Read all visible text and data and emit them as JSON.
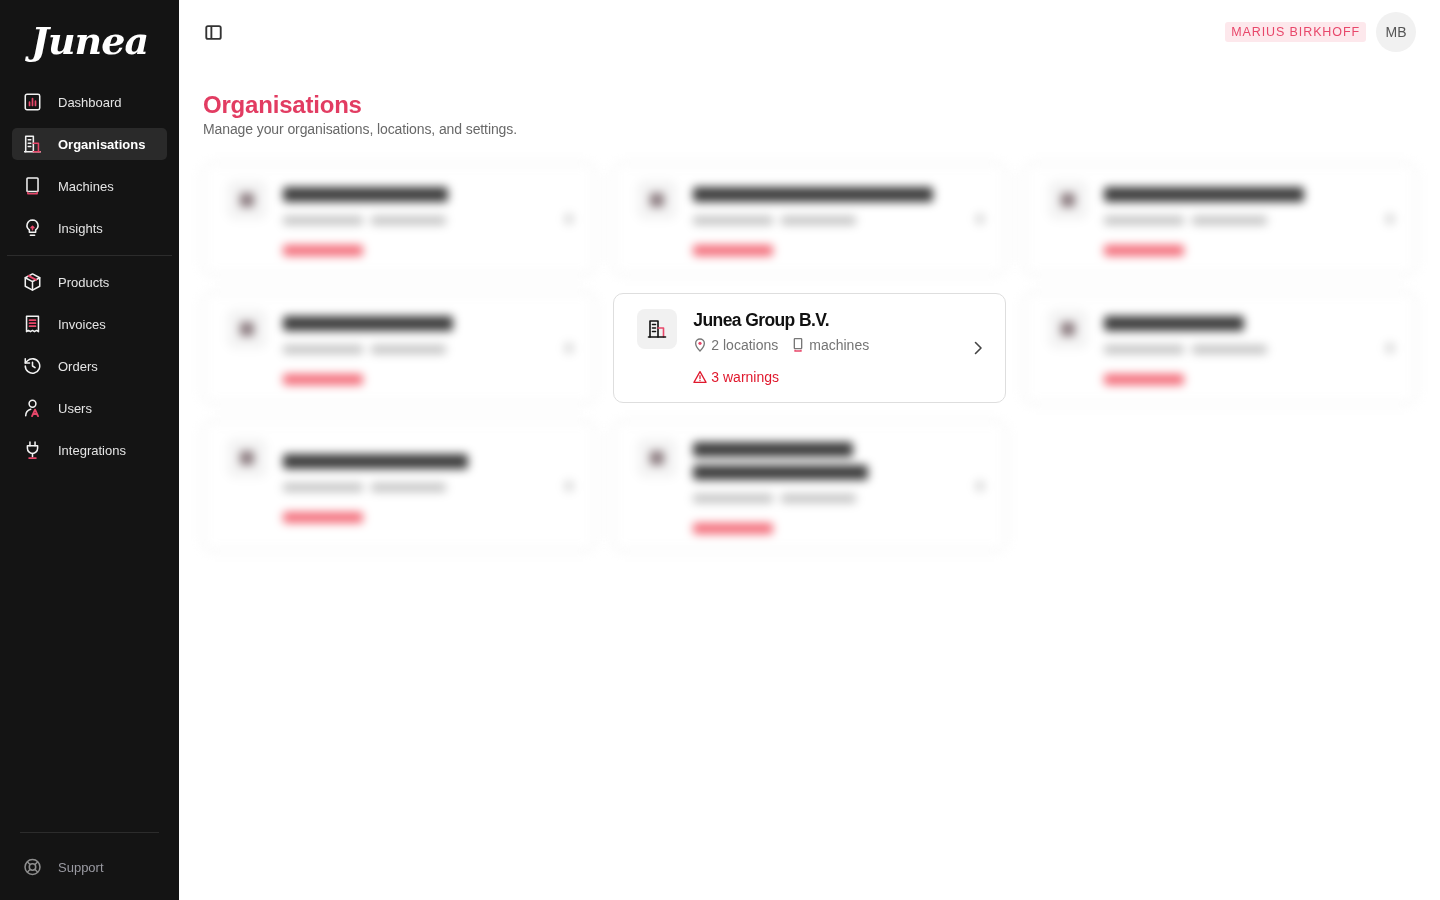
{
  "sidebar": {
    "logo": "Junea",
    "groups": [
      {
        "items": [
          {
            "label": "Dashboard",
            "selected": false
          },
          {
            "label": "Organisations",
            "selected": true
          },
          {
            "label": "Machines",
            "selected": false
          },
          {
            "label": "Insights",
            "selected": false
          }
        ]
      },
      {
        "items": [
          {
            "label": "Products",
            "selected": false
          },
          {
            "label": "Invoices",
            "selected": false
          },
          {
            "label": "Orders",
            "selected": false
          },
          {
            "label": "Users",
            "selected": false
          },
          {
            "label": "Integrations",
            "selected": false
          }
        ]
      }
    ],
    "footer": {
      "label": "Support"
    }
  },
  "header": {
    "user_name": "MARIUS BIRKHOFF",
    "avatar_initials": "MB"
  },
  "page": {
    "title": "Organisations",
    "subtitle": "Manage your organisations, locations, and settings."
  },
  "organisations": [
    {
      "kind": "blurred",
      "wraps": false
    },
    {
      "kind": "blurred",
      "wraps": false
    },
    {
      "kind": "blurred",
      "wraps": false
    },
    {
      "kind": "blurred",
      "wraps": false
    },
    {
      "kind": "card",
      "name": "Junea Group B.V.",
      "locations": "2 locations",
      "machines": "machines",
      "warnings": "3 warnings"
    },
    {
      "kind": "blurred",
      "wraps": false
    },
    {
      "kind": "blurred",
      "wraps": false
    },
    {
      "kind": "blurred",
      "wraps": true
    }
  ]
}
